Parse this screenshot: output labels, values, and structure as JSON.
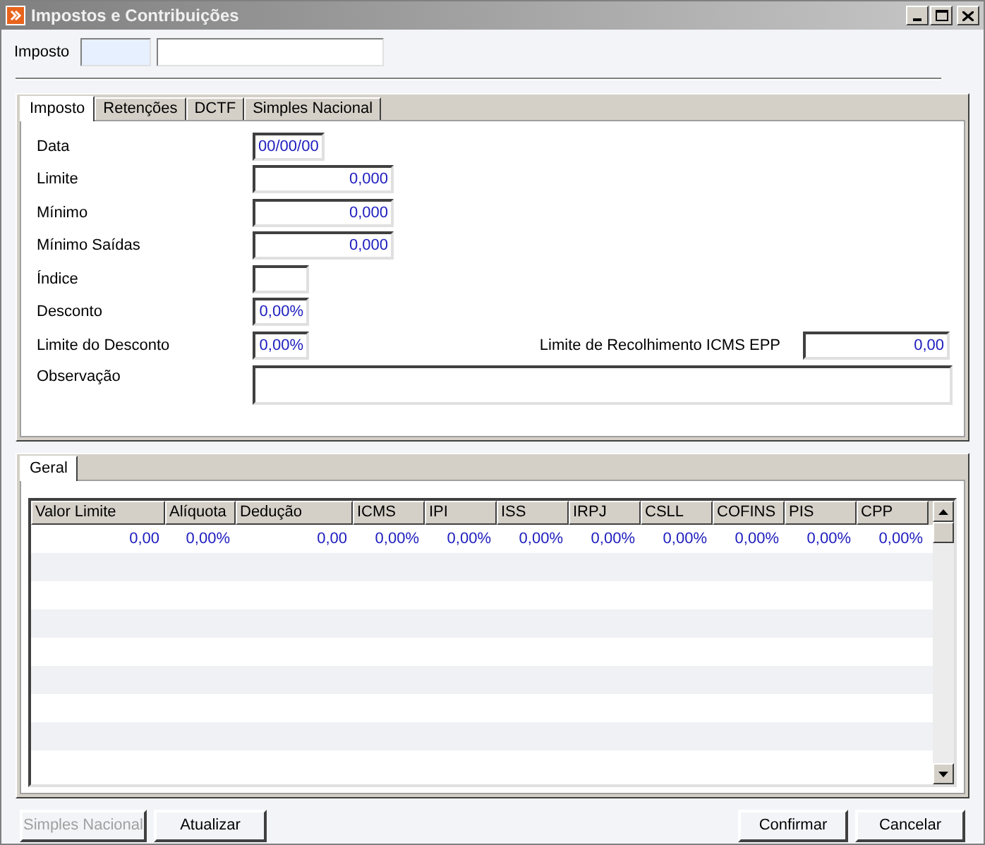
{
  "window": {
    "title": "Impostos e Contribuições"
  },
  "imposto": {
    "label": "Imposto"
  },
  "tabs": [
    {
      "label": "Imposto",
      "selected": true
    },
    {
      "label": "Retenções",
      "selected": false
    },
    {
      "label": "DCTF",
      "selected": false
    },
    {
      "label": "Simples Nacional",
      "selected": false
    }
  ],
  "fields": [
    {
      "label": "Data",
      "value": "00/00/00",
      "kind": "date"
    },
    {
      "label": "Limite",
      "value": "0,000",
      "kind": "amount"
    },
    {
      "label": "Mínimo",
      "value": "0,000",
      "kind": "amount"
    },
    {
      "label": "Mínimo Saídas",
      "value": "0,000",
      "kind": "amount"
    },
    {
      "label": "Índice",
      "kind": "index"
    },
    {
      "label": "Desconto",
      "value": "0,00%",
      "kind": "percent"
    },
    {
      "label": "Limite do Desconto",
      "value": "0,00%",
      "kind": "percent"
    }
  ],
  "limite_icms": {
    "label": "Limite de Recolhimento ICMS EPP",
    "value": "0,00"
  },
  "observacao": {
    "label": "Observação"
  },
  "grid_tabs": [
    {
      "label": "Geral",
      "selected": true
    }
  ],
  "table": {
    "columns": [
      "Valor Limite",
      "Alíquota",
      "Dedução",
      "ICMS",
      "IPI",
      "ISS",
      "IRPJ",
      "CSLL",
      "COFINS",
      "PIS",
      "CPP"
    ],
    "rows": [
      [
        "0,00",
        "0,00%",
        "0,00",
        "0,00%",
        "0,00%",
        "0,00%",
        "0,00%",
        "0,00%",
        "0,00%",
        "0,00%",
        "0,00%"
      ]
    ]
  },
  "left_buttons": [
    {
      "label": "Simples Nacional",
      "disabled": true
    },
    {
      "label": "Atualizar",
      "disabled": false
    }
  ],
  "right_buttons": [
    {
      "label": "Confirmar"
    },
    {
      "label": "Cancelar"
    }
  ]
}
